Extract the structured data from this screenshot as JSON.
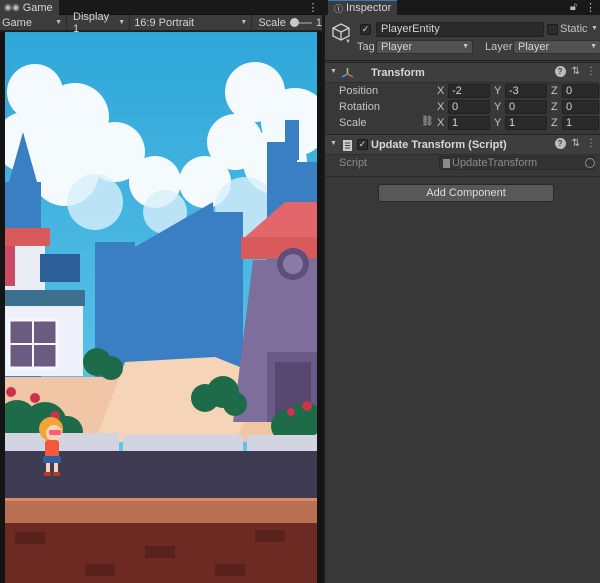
{
  "game": {
    "tab_label": "Game",
    "display_mode": "Game",
    "display": "Display 1",
    "aspect": "16:9 Portrait",
    "scale_label": "Scale",
    "scale_value": "1"
  },
  "inspector": {
    "tab_label": "Inspector",
    "object_active": true,
    "object_name": "PlayerEntity",
    "static_label": "Static",
    "tag_label": "Tag",
    "tag_value": "Player",
    "layer_label": "Layer",
    "layer_value": "Player"
  },
  "transform": {
    "title": "Transform",
    "rows": [
      {
        "label": "Position",
        "x": "-2",
        "y": "-3",
        "z": "0"
      },
      {
        "label": "Rotation",
        "x": "0",
        "y": "0",
        "z": "0"
      },
      {
        "label": "Scale",
        "x": "1",
        "y": "1",
        "z": "1"
      }
    ],
    "axis_x": "X",
    "axis_y": "Y",
    "axis_z": "Z"
  },
  "script_component": {
    "title": "Update Transform (Script)",
    "enabled": true,
    "script_label": "Script",
    "script_value": "UpdateTransform"
  },
  "add_component_label": "Add Component",
  "colors": {
    "accent": "#3a79bb",
    "panel_bg": "#383838",
    "header_bg": "#3c3c3c",
    "sky": "#3fb4e2"
  },
  "icons": {
    "game_tab": "gamepad-icon",
    "inspector_tab": "info-icon",
    "lock": "lock-icon",
    "menu": "kebab-menu-icon",
    "gameobject": "cube-icon",
    "transform": "transform-axes-icon",
    "script": "script-file-icon",
    "help": "help-icon",
    "preset": "sliders-icon",
    "constrain": "link-icon"
  }
}
